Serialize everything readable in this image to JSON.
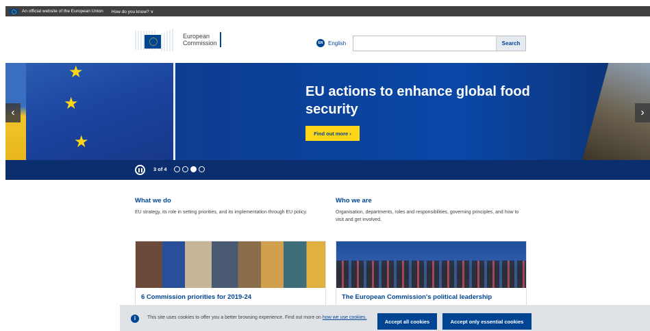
{
  "topbar": {
    "official_text": "An official website of the European Union",
    "how_text": "How do you know? ∨"
  },
  "header": {
    "logo_line1": "European",
    "logo_line2": "Commission",
    "lang_code": "EN",
    "lang_label": "English",
    "search_placeholder": "",
    "search_button": "Search"
  },
  "hero": {
    "title": "EU actions to enhance global food security",
    "cta": "Find out more ›",
    "counter": "3 of 4",
    "prev_glyph": "‹",
    "next_glyph": "›",
    "active_slide": 3,
    "total_slides": 4
  },
  "sections": [
    {
      "title": "What we do",
      "description": "EU strategy, its role in setting priorities, and its implementation through EU policy.",
      "card_title": "6 Commission priorities for 2019-24"
    },
    {
      "title": "Who we are",
      "description": "Organisation, departments, roles and responsibilities, governing principles, and how to visit and get involved.",
      "card_title": "The European Commission's political leadership"
    }
  ],
  "cookie": {
    "info_glyph": "i",
    "message": "This site uses cookies to offer you a better browsing experience. Find out more on ",
    "link_text": "how we use cookies.",
    "accept_all": "Accept all cookies",
    "accept_essential": "Accept only essential cookies"
  },
  "colors": {
    "brand_blue": "#004494",
    "accent_yellow": "#ffd617",
    "topbar": "#404040"
  }
}
